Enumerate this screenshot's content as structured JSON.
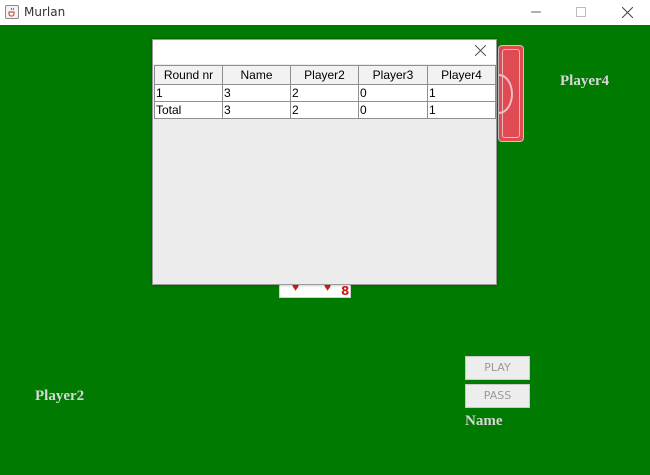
{
  "window": {
    "title": "Murlan",
    "icon": "java-cup-icon",
    "controls": [
      "minimize",
      "maximize",
      "close"
    ]
  },
  "table": {
    "background_color": "#017a01"
  },
  "players": {
    "top_right": "Player4",
    "left": "Player2",
    "self": "Name"
  },
  "played_card": {
    "rank": "8",
    "suit": "hearts",
    "suit_symbol": "♥",
    "color": "#d11a1a"
  },
  "buttons": {
    "play": "PLAY",
    "pass": "PASS"
  },
  "score_dialog": {
    "columns": [
      "Round nr",
      "Name",
      "Player2",
      "Player3",
      "Player4"
    ],
    "rows": [
      [
        "1",
        "3",
        "2",
        "0",
        "1"
      ],
      [
        "Total",
        "3",
        "2",
        "0",
        "1"
      ]
    ]
  }
}
